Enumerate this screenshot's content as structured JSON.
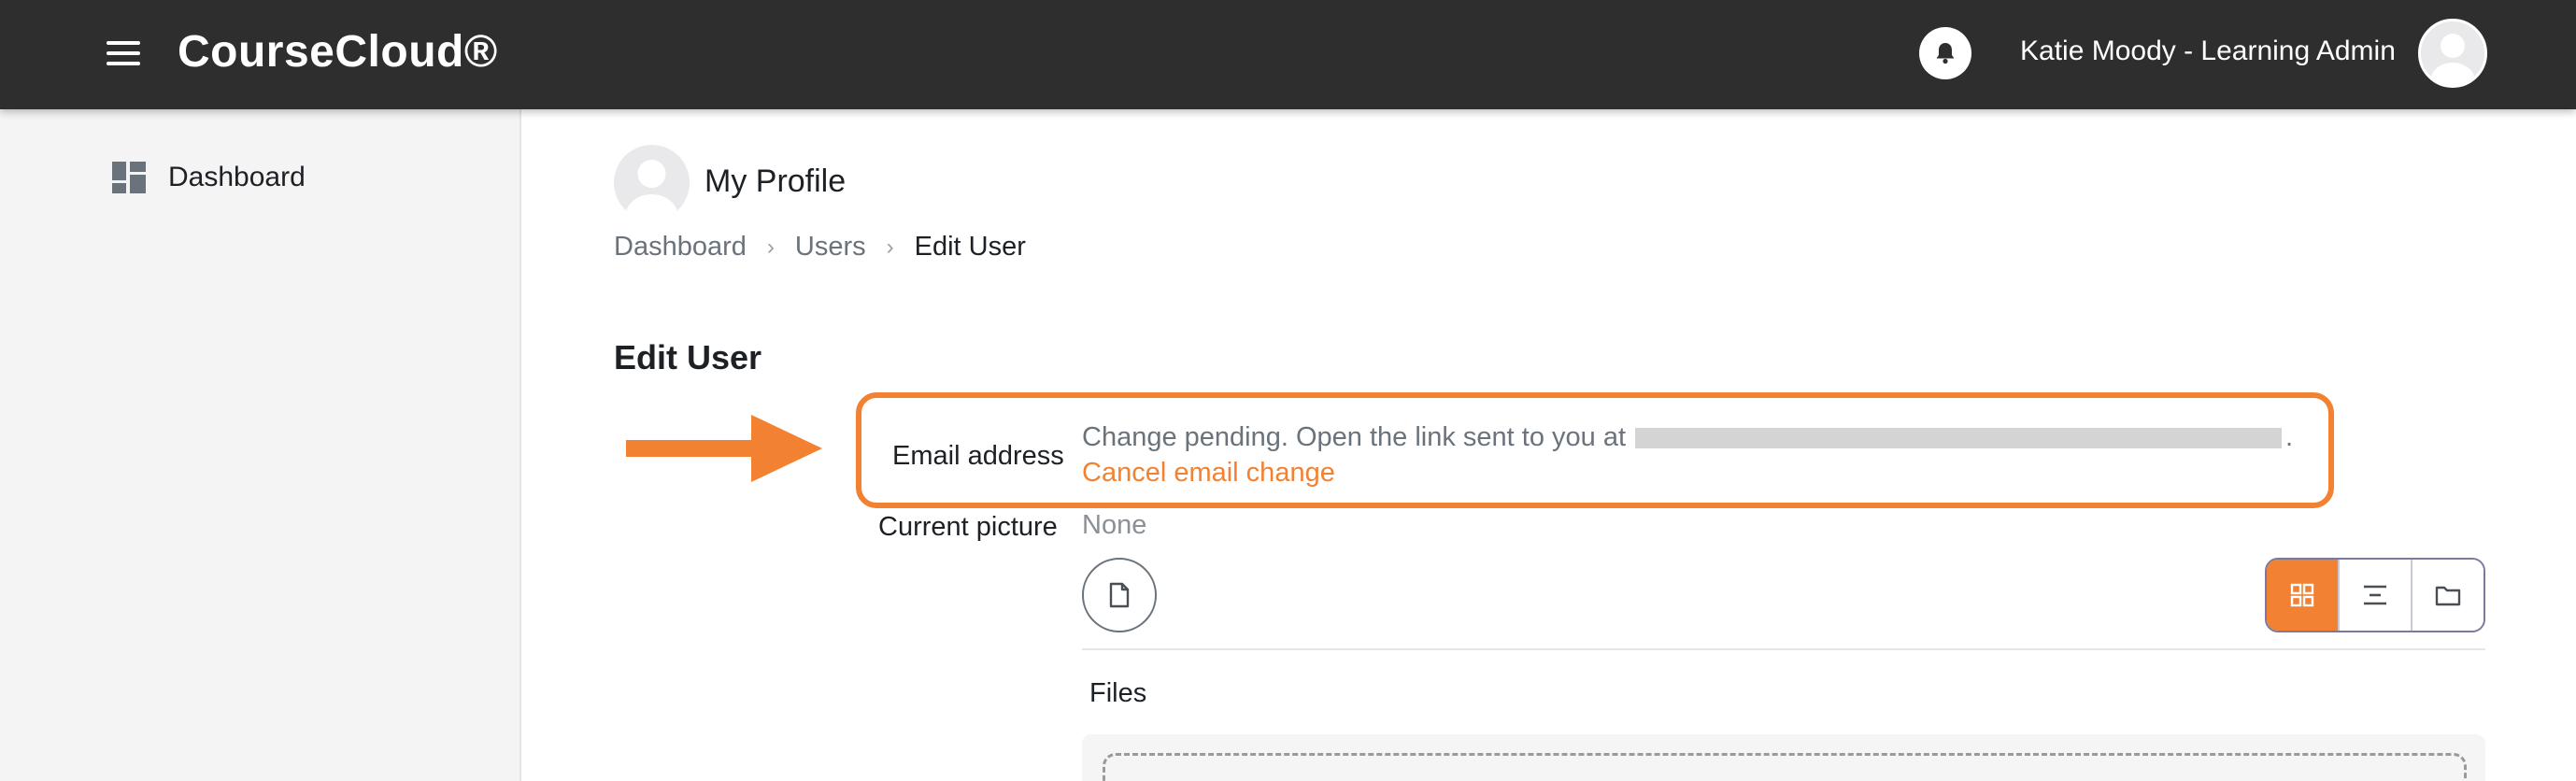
{
  "app": {
    "brand": "CourseCloud®"
  },
  "header": {
    "user_name": "Katie Moody - Learning Admin"
  },
  "sidebar": {
    "items": [
      {
        "label": "Dashboard",
        "icon": "dashboard-icon"
      }
    ]
  },
  "page": {
    "title": "My Profile",
    "breadcrumb": [
      "Dashboard",
      "Users",
      "Edit User"
    ],
    "section_title": "Edit User"
  },
  "form": {
    "email_label": "Email address",
    "pending_text": "Change pending. Open the link sent to you at",
    "pending_end": ".",
    "cancel_link": "Cancel email change",
    "picture_label": "Current picture",
    "picture_value": "None",
    "files_label": "Files"
  },
  "colors": {
    "accent": "#f28131",
    "navbar": "#2e2e2e",
    "sidebar": "#f4f4f4"
  }
}
